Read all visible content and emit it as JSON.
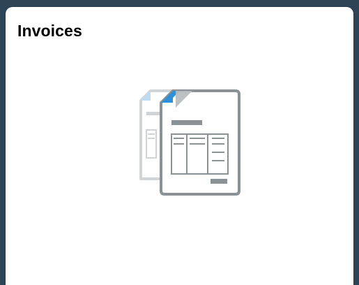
{
  "tile": {
    "title": "Invoices",
    "icon": "invoice-documents-icon"
  },
  "colors": {
    "frame": "#2e4557",
    "tile_background": "#ffffff",
    "title_text": "#000000",
    "icon_gray": "#8a9296",
    "icon_blue_accent": "#2f8fd8",
    "icon_light_blue": "#9cc8ea"
  }
}
